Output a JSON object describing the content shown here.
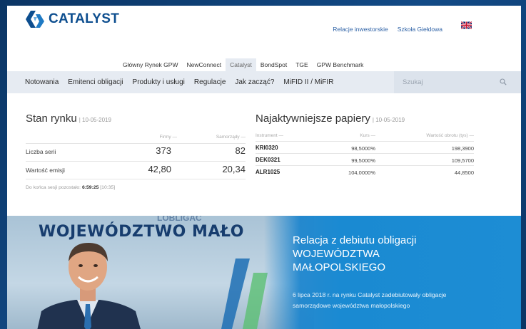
{
  "header": {
    "logo_text": "CATALYST",
    "top_links": [
      "Relacje inwestorskie",
      "Szkoła Giełdowa"
    ],
    "language_flag": "uk-flag-icon"
  },
  "markets": {
    "items": [
      "Główny Rynek GPW",
      "NewConnect",
      "Catalyst",
      "BondSpot",
      "TGE",
      "GPW Benchmark"
    ],
    "active": "Catalyst"
  },
  "nav": {
    "items": [
      "Notowania",
      "Emitenci obligacji",
      "Produkty i usługi",
      "Regulacje",
      "Jak zacząć?",
      "MiFID II / MiFIR"
    ],
    "search_placeholder": "Szukaj"
  },
  "market_state": {
    "title": "Stan rynku",
    "date": "| 10-05-2019",
    "col_firms": "Firmy —",
    "col_local": "Samorządy —",
    "rows": [
      {
        "label": "Liczba serii",
        "firms": "373",
        "local": "82"
      },
      {
        "label": "Wartość emisji",
        "firms": "42,80",
        "local": "20,34"
      }
    ],
    "session_label": "Do końca sesji pozostało:",
    "session_time": "6:59:25",
    "session_clock": "[10:35]"
  },
  "active_papers": {
    "title": "Najaktywniejsze papiery",
    "date": "| 10-05-2019",
    "col_instrument": "Instrument —",
    "col_price": "Kurs —",
    "col_volume": "Wartość obrotu (tys) —",
    "rows": [
      {
        "instrument": "KRI0320",
        "price": "98,5000%",
        "volume": "198,3900"
      },
      {
        "instrument": "DEK0321",
        "price": "99,5000%",
        "volume": "109,5700"
      },
      {
        "instrument": "ALR1025",
        "price": "104,0000%",
        "volume": "44,8500"
      }
    ]
  },
  "banner": {
    "sign_text": "WOJEWÓDZTWO MAŁO",
    "sign_text_top": "LOBLIGAC",
    "title_line1": "Relacja z debiutu obligacji",
    "title_line2": "WOJEWÓDZTWA",
    "title_line3": "MAŁOPOLSKIEGO",
    "text": "6 lipca 2018 r. na rynku Catalyst zadebiutowały obligacje samorządowe województwa małopolskiego"
  },
  "colors": {
    "brand": "#0d4e8f",
    "link": "#2e62a6",
    "nav_bg": "#e6ebf2",
    "banner_blue": "#1d8dd4"
  }
}
